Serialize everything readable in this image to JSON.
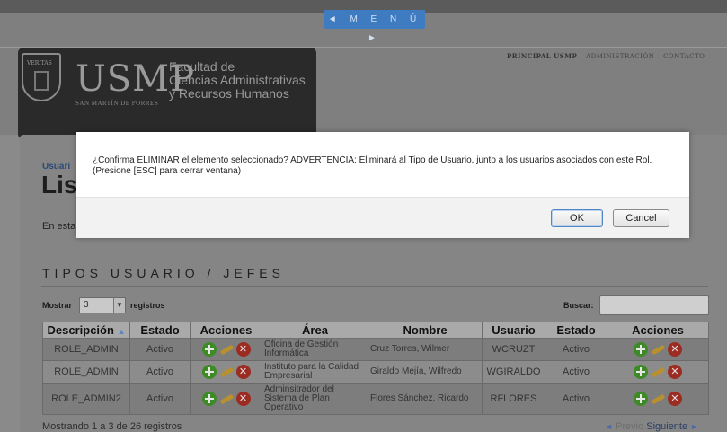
{
  "menu": {
    "label": "◄ M E N Ú ►"
  },
  "logo": {
    "name": "USMP",
    "subtitle": "SAN MARTÍN DE PORRES",
    "crest_text": "VERITAS",
    "faculty": [
      "Facultad de",
      "Ciencias Administrativas",
      "y Recursos Humanos"
    ]
  },
  "toplinks": [
    "PRINCIPAL USMP",
    "ADMINISTRACIÓN",
    "CONTACTO"
  ],
  "page": {
    "breadcrumb": "Usuari",
    "title": "Lis",
    "intro": "En esta",
    "section_title": "TIPOS USUARIO / JEFES"
  },
  "controls": {
    "show_label": "Mostrar",
    "page_size": "3",
    "records_label": "registros",
    "search_label": "Buscar:",
    "search_value": ""
  },
  "table": {
    "headers": [
      "Descripción",
      "Estado",
      "Acciones",
      "Área",
      "Nombre",
      "Usuario",
      "Estado",
      "Acciones"
    ],
    "rows": [
      {
        "descripcion": "ROLE_ADMIN",
        "estado": "Activo",
        "area": "Oficina de Gestión Informática",
        "nombre": "Cruz Torres, Wilmer",
        "usuario": "WCRUZT",
        "estado2": "Activo"
      },
      {
        "descripcion": "ROLE_ADMIN",
        "estado": "Activo",
        "area": "Instituto para la Calidad Empresarial",
        "nombre": "Giraldo Mejía, Wilfredo",
        "usuario": "WGIRALDO",
        "estado2": "Activo"
      },
      {
        "descripcion": "ROLE_ADMIN2",
        "estado": "Activo",
        "area": "Adminsitrador del Sistema de Plan Operativo",
        "nombre": "Flores Sánchez, Ricardo",
        "usuario": "RFLORES",
        "estado2": "Activo"
      }
    ]
  },
  "footer": {
    "info": "Mostrando 1 a 3 de 26 registros",
    "prev": "Previo",
    "next": "Siguiente"
  },
  "dialog": {
    "message_line1": "¿Confirma ELIMINAR el elemento seleccionado? ADVERTENCIA: Eliminará al Tipo de Usuario, junto a los usuarios asociados con este Rol.",
    "message_line2": "(Presione [ESC] para cerrar ventana)",
    "ok": "OK",
    "cancel": "Cancel"
  },
  "colors": {
    "menu_tab": "#3f7bc0",
    "add_icon": "#3d8a26",
    "delete_icon": "#9c2b22",
    "breadcrumb": "#2b4a78"
  }
}
